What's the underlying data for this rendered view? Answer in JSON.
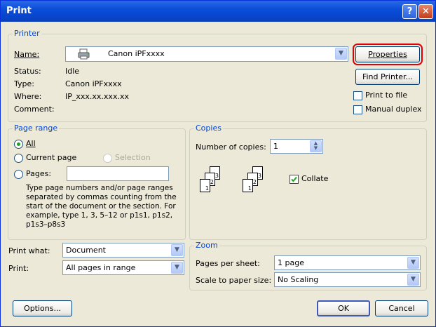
{
  "window": {
    "title": "Print",
    "help_glyph": "?",
    "close_glyph": "✕"
  },
  "printer": {
    "legend": "Printer",
    "name_label": "Name:",
    "name_value": "Canon iPFxxxx",
    "status_label": "Status:",
    "status_value": "Idle",
    "type_label": "Type:",
    "type_value": "Canon iPFxxxx",
    "where_label": "Where:",
    "where_value": "IP_xxx.xx.xxx.xx",
    "comment_label": "Comment:",
    "properties_button": "Properties",
    "find_printer_button": "Find Printer...",
    "print_to_file_label": "Print to file",
    "manual_duplex_label": "Manual duplex",
    "print_to_file_checked": false,
    "manual_duplex_checked": false
  },
  "page_range": {
    "legend": "Page range",
    "all_label": "All",
    "current_page_label": "Current page",
    "selection_label": "Selection",
    "pages_label": "Pages:",
    "pages_value": "",
    "selected": "All",
    "help_text": "Type page numbers and/or page ranges separated by commas counting from the start of the document or the section. For example, type 1, 3, 5–12 or p1s1, p1s2, p1s3–p8s3"
  },
  "copies": {
    "legend": "Copies",
    "number_label": "Number of copies:",
    "number_value": "1",
    "collate_label": "Collate",
    "collate_checked": true,
    "page_numbers": [
      "1",
      "2",
      "3"
    ]
  },
  "print_what": {
    "label": "Print what:",
    "value": "Document"
  },
  "print": {
    "label": "Print:",
    "value": "All pages in range"
  },
  "zoom": {
    "legend": "Zoom",
    "pages_per_sheet_label": "Pages per sheet:",
    "pages_per_sheet_value": "1 page",
    "scale_label": "Scale to paper size:",
    "scale_value": "No Scaling"
  },
  "footer": {
    "options_button": "Options...",
    "ok_button": "OK",
    "cancel_button": "Cancel"
  },
  "colors": {
    "title_bar": "#0a4fd9",
    "legend_text": "#0046d5",
    "highlight_box": "#e0000a"
  }
}
